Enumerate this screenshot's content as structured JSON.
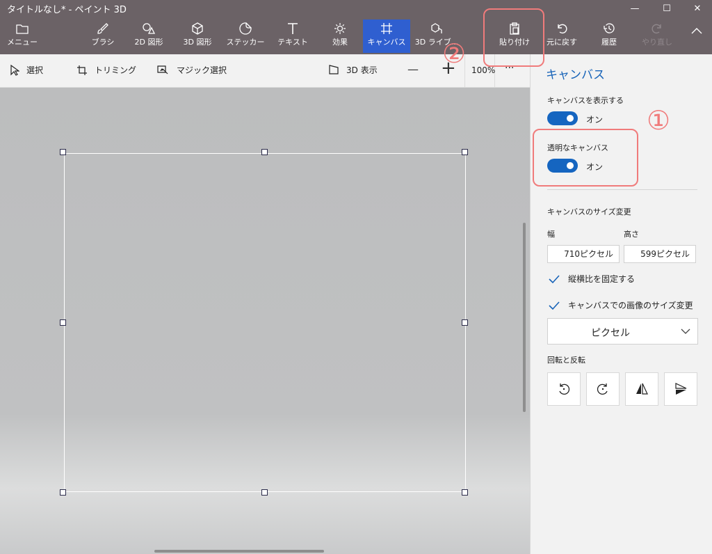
{
  "window": {
    "title": "タイトルなし* - ペイント 3D",
    "minimize": "—",
    "maximize": "☐",
    "close": "✕"
  },
  "toolbar": {
    "menu": "メニュー",
    "brush": "ブラシ",
    "shapes2d": "2D 図形",
    "shapes3d": "3D 図形",
    "stickers": "ステッカー",
    "text": "テキスト",
    "effects": "効果",
    "canvas": "キャンバス",
    "library3d": "3D ライブ...",
    "paste": "貼り付け",
    "undo": "元に戻す",
    "history": "履歴",
    "redo": "やり直し"
  },
  "subbar": {
    "select": "選択",
    "crop": "トリミング",
    "magic_select": "マジック選択",
    "view3d": "3D 表示",
    "zoom_out": "—",
    "zoom_in": "+",
    "zoom": "100%",
    "more": "···"
  },
  "panel": {
    "title": "キャンバス",
    "show_canvas_label": "キャンバスを表示する",
    "show_canvas_state": "オン",
    "transparent_label": "透明なキャンバス",
    "transparent_state": "オン",
    "resize_title": "キャンバスのサイズ変更",
    "width_label": "幅",
    "height_label": "高さ",
    "width_value": "710ピクセル",
    "height_value": "599ピクセル",
    "lock_aspect": "縦横比を固定する",
    "resize_image": "キャンバスでの画像のサイズ変更",
    "unit": "ピクセル",
    "rotate_flip": "回転と反転"
  },
  "annotations": {
    "one": "①",
    "two": "②"
  },
  "colors": {
    "titlebar": "#6b6266",
    "accent": "#2f5fd0",
    "toggle": "#1565c0",
    "panel_title": "#1763b8",
    "callout": "#f07b7b"
  }
}
